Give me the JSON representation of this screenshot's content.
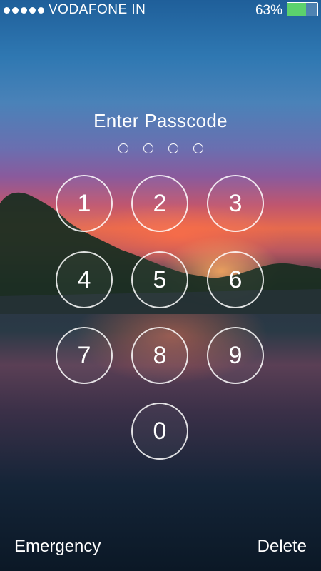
{
  "status_bar": {
    "signal_icon": "signal-dots-icon",
    "signal_strength": 5,
    "carrier": "VODAFONE IN",
    "battery_percent_label": "63%",
    "battery_icon": "battery-icon",
    "battery_level": 0.63,
    "battery_color": "#5bd16d"
  },
  "lock_screen": {
    "title": "Enter Passcode",
    "passcode_length": 4,
    "entered_digits": 0
  },
  "keypad": {
    "keys": [
      "1",
      "2",
      "3",
      "4",
      "5",
      "6",
      "7",
      "8",
      "9",
      "0"
    ]
  },
  "footer": {
    "left_label": "Emergency",
    "right_label": "Delete"
  }
}
